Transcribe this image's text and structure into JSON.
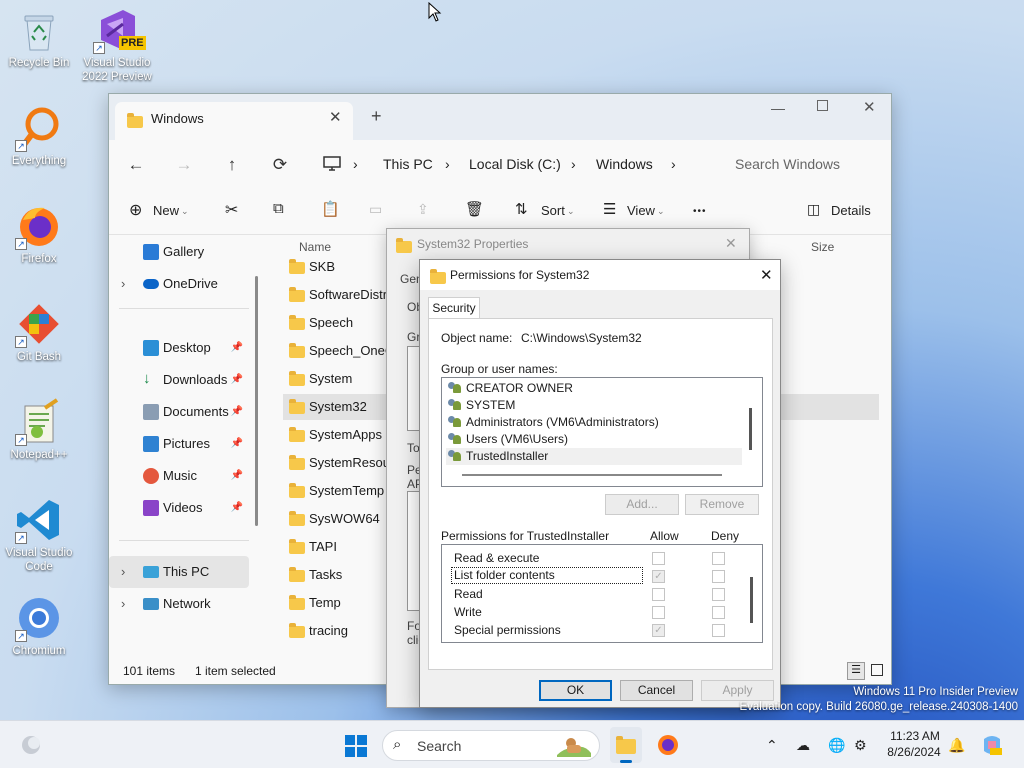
{
  "desktop": {
    "icons": [
      {
        "label": "Recycle Bin",
        "icon": "recycle-bin-icon"
      },
      {
        "label": "Visual Studio 2022 Preview",
        "icon": "visual-studio-preview-icon",
        "badge": "PRE"
      },
      {
        "label": "Everything",
        "icon": "everything-search-icon"
      },
      {
        "label": "Firefox",
        "icon": "firefox-icon"
      },
      {
        "label": "Git Bash",
        "icon": "git-bash-icon"
      },
      {
        "label": "Notepad++",
        "icon": "notepad-plus-plus-icon"
      },
      {
        "label": "Visual Studio Code",
        "icon": "vscode-icon"
      },
      {
        "label": "Chromium",
        "icon": "chromium-icon"
      }
    ]
  },
  "explorer": {
    "tab_title": "Windows",
    "new_tab": "+",
    "breadcrumbs": [
      "This PC",
      "Local Disk (C:)",
      "Windows"
    ],
    "search_placeholder": "Search Windows",
    "toolbar": {
      "new": "New",
      "sort": "Sort",
      "view": "View",
      "more": "•••",
      "details": "Details"
    },
    "sidebar": [
      {
        "label": "Gallery",
        "pinned": false,
        "expand": false
      },
      {
        "label": "OneDrive",
        "pinned": false,
        "expand": true
      },
      {
        "label": "Desktop",
        "pinned": true,
        "expand": false
      },
      {
        "label": "Downloads",
        "pinned": true,
        "expand": false
      },
      {
        "label": "Documents",
        "pinned": true,
        "expand": false
      },
      {
        "label": "Pictures",
        "pinned": true,
        "expand": false
      },
      {
        "label": "Music",
        "pinned": true,
        "expand": false
      },
      {
        "label": "Videos",
        "pinned": true,
        "expand": false
      },
      {
        "label": "This PC",
        "pinned": false,
        "expand": true
      },
      {
        "label": "Network",
        "pinned": false,
        "expand": true
      }
    ],
    "columns": {
      "name": "Name",
      "size": "Size"
    },
    "files": [
      "SKB",
      "SoftwareDistrib",
      "Speech",
      "Speech_OneCo",
      "System",
      "System32",
      "SystemApps",
      "SystemResourc",
      "SystemTemp",
      "SysWOW64",
      "TAPI",
      "Tasks",
      "Temp",
      "tracing"
    ],
    "selected_file": "System32",
    "status": {
      "items": "101 items",
      "selected": "1 item selected"
    }
  },
  "properties": {
    "title": "System32 Properties",
    "fragments": [
      "Gen",
      "Ob",
      "Gro",
      "To",
      "Pe",
      "AP",
      "For",
      "clic"
    ]
  },
  "permissions": {
    "title": "Permissions for System32",
    "tab": "Security",
    "object_label": "Object name:",
    "object_value": "C:\\Windows\\System32",
    "group_label": "Group or user names:",
    "users": [
      "CREATOR OWNER",
      "SYSTEM",
      "Administrators (VM6\\Administrators)",
      "Users (VM6\\Users)",
      "TrustedInstaller"
    ],
    "selected_user": "TrustedInstaller",
    "add": "Add...",
    "remove": "Remove",
    "perm_label": "Permissions for TrustedInstaller",
    "allow": "Allow",
    "deny": "Deny",
    "permissions": [
      {
        "name": "Read & execute",
        "allow": false,
        "deny": false
      },
      {
        "name": "List folder contents",
        "allow": true,
        "deny": false
      },
      {
        "name": "Read",
        "allow": false,
        "deny": false
      },
      {
        "name": "Write",
        "allow": false,
        "deny": false
      },
      {
        "name": "Special permissions",
        "allow": true,
        "deny": false
      }
    ],
    "ok": "OK",
    "cancel": "Cancel",
    "apply": "Apply"
  },
  "watermark": {
    "line1": "Windows 11 Pro Insider Preview",
    "line2": "Evaluation copy. Build 26080.ge_release.240308-1400"
  },
  "taskbar": {
    "search_placeholder": "Search",
    "time": "11:23 AM",
    "date": "8/26/2024"
  },
  "colors": {
    "accent": "#0067c0",
    "selection": "#dce8f5",
    "folder": "#f7c84a"
  }
}
